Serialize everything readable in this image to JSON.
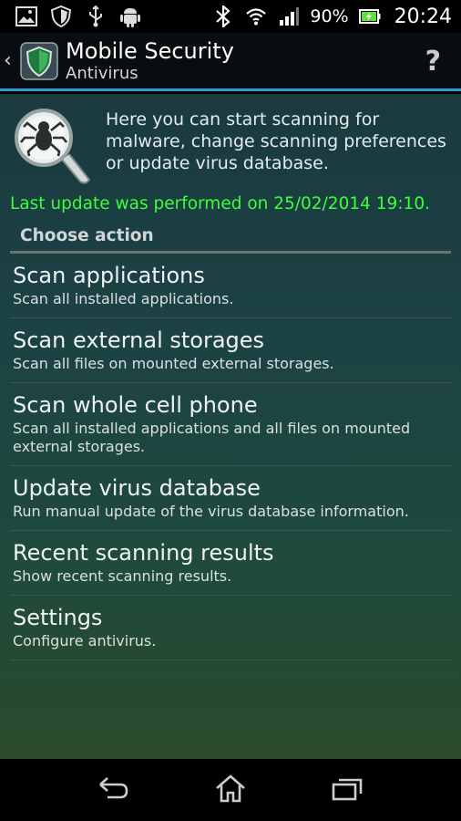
{
  "status_bar": {
    "battery_percent": "90%",
    "time": "20:24",
    "icons": [
      "gallery-icon",
      "shield-icon",
      "usb-icon",
      "android-icon",
      "bluetooth-icon",
      "wifi-icon",
      "signal-icon",
      "battery-icon"
    ]
  },
  "action_bar": {
    "title": "Mobile Security",
    "subtitle": "Antivirus",
    "help_label": "?",
    "up_label": "‹"
  },
  "intro": {
    "text": "Here you can start scanning for malware, change scanning preferences or update virus database."
  },
  "last_update": "Last update was performed on 25/02/2014 19:10.",
  "section_header": "Choose action",
  "menu": [
    {
      "title": "Scan applications",
      "description": "Scan all installed applications."
    },
    {
      "title": "Scan external storages",
      "description": "Scan all files on mounted external storages."
    },
    {
      "title": "Scan whole cell phone",
      "description": "Scan all installed applications and all files on mounted external storages."
    },
    {
      "title": "Update virus database",
      "description": "Run manual update of the virus database information."
    },
    {
      "title": "Recent scanning results",
      "description": "Show recent scanning results."
    },
    {
      "title": "Settings",
      "description": "Configure antivirus."
    }
  ],
  "nav_bar": {
    "icons": [
      "back-icon",
      "home-icon",
      "recent-apps-icon"
    ]
  },
  "colors": {
    "accent": "#2e9bd6",
    "last_update_text": "#3cff3c",
    "status_bar_bg": "#000000"
  }
}
